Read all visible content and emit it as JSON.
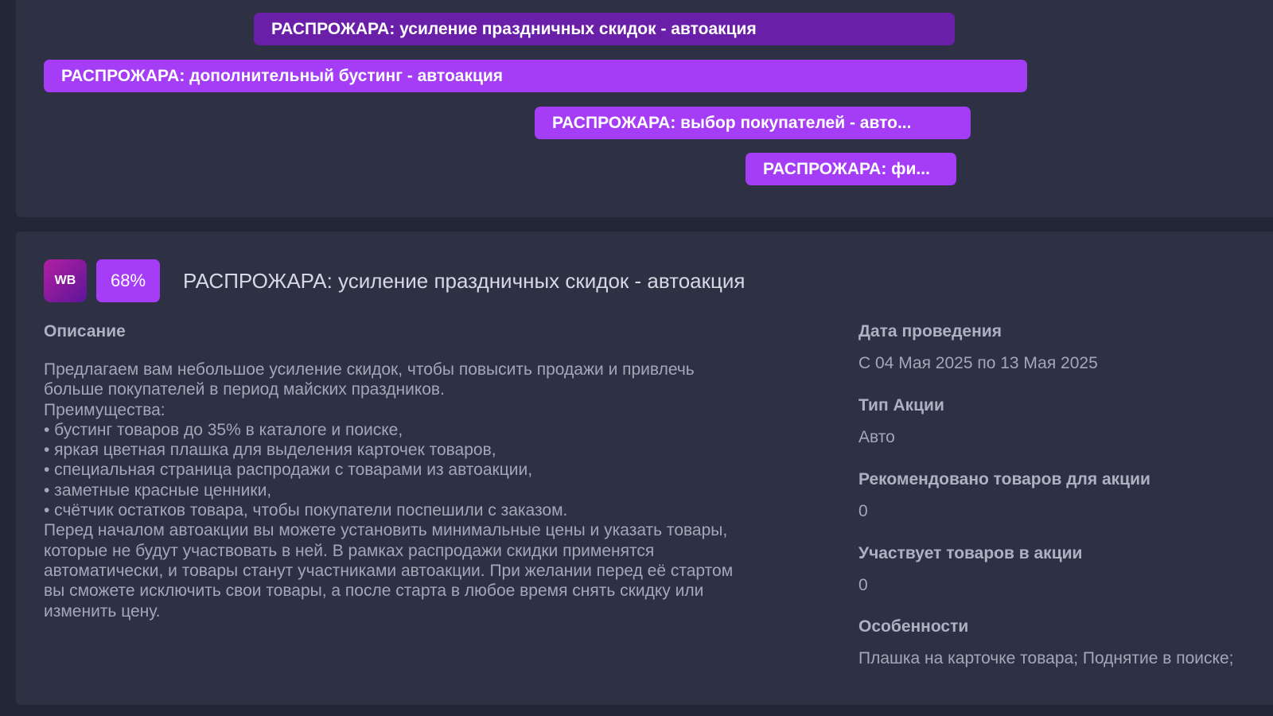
{
  "timeline": {
    "bars": [
      "РАСПРОЖАРА: усиление праздничных скидок - автоакция",
      "РАСПРОЖАРА: дополнительный бустинг - автоакция",
      "РАСПРОЖАРА: выбор покупателей - авто...",
      "РАСПРОЖАРА: фи..."
    ]
  },
  "detail": {
    "marketplace_logo": "WB",
    "discount": "68%",
    "title": "РАСПРОЖАРА: усиление праздничных скидок - автоакция",
    "description_label": "Описание",
    "description_lines": [
      "Предлагаем вам небольшое усиление скидок, чтобы повысить продажи и привлечь",
      "больше покупателей в период майских праздников.",
      "Преимущества:",
      "• бустинг товаров до 35% в каталоге и поиске,",
      "• яркая цветная плашка для выделения карточек товаров,",
      "• специальная страница распродажи с товарами из автоакции,",
      "• заметные красные ценники,",
      "• счётчик остатков товара, чтобы покупатели поспешили с заказом.",
      "Перед началом автоакции вы можете установить минимальные цены и указать товары,",
      "которые не будут участвовать в ней. В рамках распродажи скидки применятся",
      "автоматически, и товары станут участниками автоакции. При желании перед её стартом",
      "вы сможете исключить свои товары, а после старта в любое время снять скидку или",
      "изменить цену."
    ],
    "date_label": "Дата проведения",
    "date_value": "С 04 Мая 2025 по 13 Мая 2025",
    "type_label": "Тип Акции",
    "type_value": "Авто",
    "recommended_label": "Рекомендовано товаров для акции",
    "recommended_value": "0",
    "participating_label": "Участвует товаров в акции",
    "participating_value": "0",
    "features_label": "Особенности",
    "features_value": "Плашка на карточке товара; Поднятие в поиске;"
  }
}
